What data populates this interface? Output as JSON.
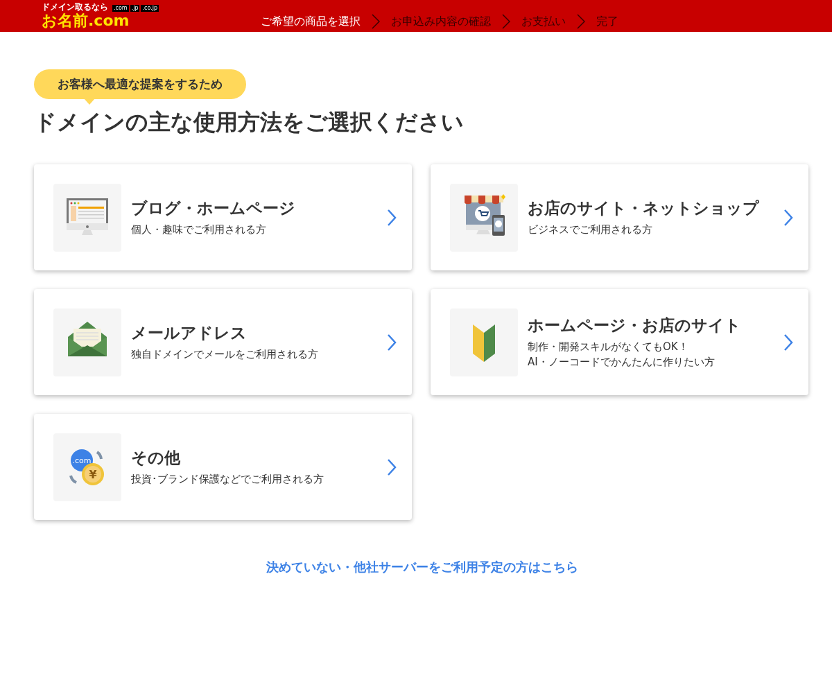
{
  "header": {
    "logo": {
      "tagline": "ドメイン取るなら",
      "name": "お名前.com",
      "tlds": [
        ".com",
        ".jp",
        ".co.jp"
      ]
    },
    "steps": [
      {
        "label": "ご希望の商品を選択",
        "selected": true
      },
      {
        "label": "お申込み内容の確認",
        "selected": false
      },
      {
        "label": "お支払い",
        "selected": false
      },
      {
        "label": "完了",
        "selected": false
      }
    ]
  },
  "badge": "お客様へ最適な提案をするため",
  "heading": "ドメインの主な使用方法をご選択ください",
  "options": [
    {
      "kind": "monitor",
      "title": "ブログ・ホームページ",
      "lines": [
        "個人・趣味でご利用される方"
      ]
    },
    {
      "kind": "shop",
      "title": "お店のサイト・ネットショップ",
      "lines": [
        "ビジネスでご利用される方"
      ]
    },
    {
      "kind": "mail",
      "title": "メールアドレス",
      "lines": [
        "独自ドメインでメールをご利用される方"
      ]
    },
    {
      "kind": "beginner",
      "title": "ホームページ・お店のサイト",
      "lines": [
        "制作・開発スキルがなくてもOK！",
        "AI・ノーコードでかんたんに作りたい方"
      ]
    },
    {
      "kind": "domain",
      "icon_text": [
        ".com",
        "¥"
      ],
      "title": "その他",
      "lines": [
        "投資･ブランド保護などでご利用される方"
      ]
    }
  ],
  "footer_link": "決めていない・他社サーバーをご利用予定の方はこちら"
}
